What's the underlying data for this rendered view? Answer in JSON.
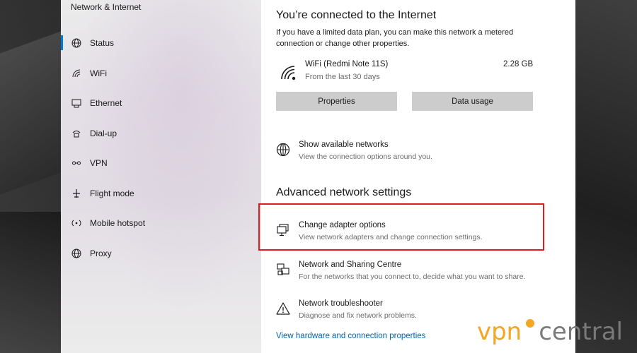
{
  "sidebar": {
    "title": "Network & Internet",
    "items": [
      {
        "label": "Status",
        "icon": "status-globe-icon",
        "active": true
      },
      {
        "label": "WiFi",
        "icon": "wifi-icon"
      },
      {
        "label": "Ethernet",
        "icon": "ethernet-icon"
      },
      {
        "label": "Dial-up",
        "icon": "dialup-icon"
      },
      {
        "label": "VPN",
        "icon": "vpn-icon"
      },
      {
        "label": "Flight mode",
        "icon": "airplane-icon"
      },
      {
        "label": "Mobile hotspot",
        "icon": "hotspot-icon"
      },
      {
        "label": "Proxy",
        "icon": "proxy-globe-icon"
      }
    ]
  },
  "main": {
    "heading": "You’re connected to the Internet",
    "description": "If you have a limited data plan, you can make this network a metered connection or change other properties.",
    "connection": {
      "name": "WiFi (Redmi Note 11S)",
      "subtitle": "From the last 30 days",
      "usage": "2.28 GB"
    },
    "buttons": {
      "properties": "Properties",
      "data_usage": "Data usage"
    },
    "show_networks": {
      "title": "Show available networks",
      "subtitle": "View the connection options around you."
    },
    "advanced_heading": "Advanced network settings",
    "adapter": {
      "title": "Change adapter options",
      "subtitle": "View network adapters and change connection settings."
    },
    "sharing": {
      "title": "Network and Sharing Centre",
      "subtitle": "For the networks that you connect to, decide what you want to share."
    },
    "troubleshooter": {
      "title": "Network troubleshooter",
      "subtitle": "Diagnose and fix network problems."
    },
    "link": "View hardware and connection properties"
  },
  "watermark": {
    "vpn": "vpn",
    "central": "central"
  },
  "colors": {
    "accent": "#0078d4",
    "link": "#0063b1",
    "highlight": "#e11b22",
    "watermark_orange": "#f5a623"
  }
}
